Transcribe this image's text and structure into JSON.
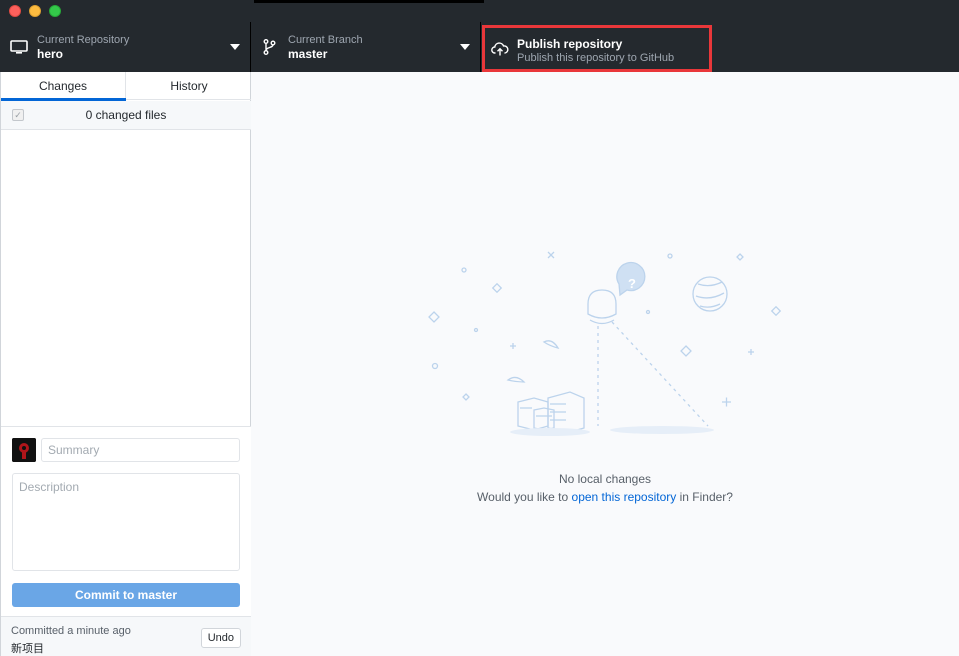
{
  "toolbar": {
    "repo_label": "Current Repository",
    "repo_value": "hero",
    "branch_label": "Current Branch",
    "branch_value": "master",
    "publish_label": "Publish repository",
    "publish_sub": "Publish this repository to GitHub"
  },
  "sidebar": {
    "tabs": [
      {
        "label": "Changes"
      },
      {
        "label": "History"
      }
    ],
    "files_count": "0 changed files",
    "summary_placeholder": "Summary",
    "description_placeholder": "Description",
    "commit_button": "Commit to master",
    "last_commit_time": "Committed a minute ago",
    "last_commit_message": "新项目",
    "undo_label": "Undo"
  },
  "main": {
    "no_changes_title": "No local changes",
    "prompt_before": "Would you like to ",
    "prompt_link": "open this repository",
    "prompt_after": " in Finder?"
  },
  "colors": {
    "toolbar_bg": "#24292e",
    "accent": "#0366d6",
    "highlight_box": "#e9373a",
    "commit_button": "#6aa6e6"
  }
}
